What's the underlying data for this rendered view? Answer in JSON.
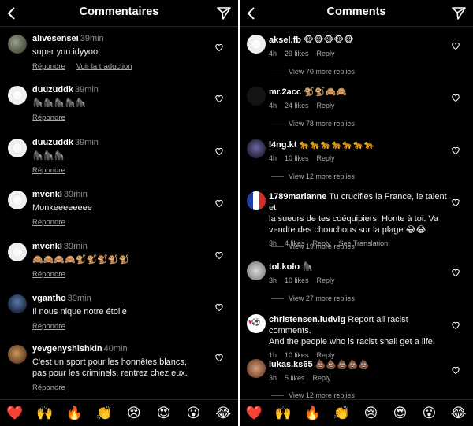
{
  "left": {
    "title": "Commentaires",
    "comments": [
      {
        "user": "alivesensei",
        "time": "39min",
        "text": "super you idyyoot",
        "reply": "Répondre",
        "translate": "Voir la traduction",
        "avatar": "photo-thumbnail"
      },
      {
        "user": "duuzuddk",
        "time": "39min",
        "text": "🦍🦍🦍🦍🦍",
        "reply": "Répondre",
        "avatar": "default-avatar"
      },
      {
        "user": "duuzuddk",
        "time": "39min",
        "text": "🦍🦍🦍",
        "reply": "Répondre",
        "avatar": "default-avatar"
      },
      {
        "user": "mvcnkl",
        "time": "39min",
        "text": "Monkeeeeeeee",
        "reply": "Répondre",
        "avatar": "default-avatar"
      },
      {
        "user": "mvcnkl",
        "time": "39min",
        "text": "🙈🙈🙈🙈🐒🐒🐒🐒🐒",
        "reply": "Répondre",
        "avatar": "default-avatar"
      },
      {
        "user": "vgantho",
        "time": "39min",
        "text": "Il nous nique notre étoile",
        "reply": "Répondre",
        "avatar": "photo-thumbnail"
      },
      {
        "user": "yevgenyshishkin",
        "time": "40min",
        "text_line1": "C'est un sport pour les honnêtes blancs,",
        "text_line2": "pas pour les criminels, rentrez chez eux.",
        "reply": "Répondre",
        "avatar": "painting-thumbnail"
      }
    ],
    "emojis": [
      "❤️",
      "🙌",
      "🔥",
      "👏",
      "😢",
      "😍",
      "😮",
      "😂"
    ]
  },
  "right": {
    "title": "Comments",
    "comments": [
      {
        "user": "aksel.fb",
        "text": "🐵🐵🐵🐵🐵",
        "time": "4h",
        "likes": "29 likes",
        "reply": "Reply",
        "more": "View 70 more replies",
        "avatar": "default-avatar"
      },
      {
        "user": "mr.2acc",
        "text": "🐒🐒🙈🙈",
        "time": "4h",
        "likes": "24 likes",
        "reply": "Reply",
        "more": "View 78 more replies",
        "avatar": "dark-avatar"
      },
      {
        "user": "l4ng.kt",
        "text": "🐆🐆🐆🐆🐆🐆🐆",
        "time": "4h",
        "likes": "10 likes",
        "reply": "Reply",
        "more": "View 12 more replies",
        "avatar": "photo-thumbnail"
      },
      {
        "user": "1789marianne",
        "text_line1": "Tu crucifies la France, le talent et",
        "text_line2": "la sueurs de tes coéquipiers. Honte à toi. Va",
        "text_line3": "vendre des chouchous sur la plage 😂😂",
        "time": "3h",
        "likes": "4 likes",
        "reply": "Reply",
        "translate": "See Translation",
        "more": "View 19 more replies",
        "avatar": "flag-avatar"
      },
      {
        "user": "tol.kolo",
        "text": "🦍",
        "time": "3h",
        "likes": "10 likes",
        "reply": "Reply",
        "more": "View 27 more replies",
        "avatar": "photo-thumbnail"
      },
      {
        "user": "christensen.ludvig",
        "text_line1": "Report all racist comments.",
        "text_line2": "And the people who is racist shall get a life!",
        "time": "1h",
        "likes": "10 likes",
        "reply": "Reply",
        "avatar": "heart-avatar"
      },
      {
        "user": "lukas.ks65",
        "text": "💩💩💩💩💩",
        "time": "3h",
        "likes": "5 likes",
        "reply": "Reply",
        "more": "View 12 more replies",
        "avatar": "photo-thumbnail"
      }
    ],
    "emojis": [
      "❤️",
      "🙌",
      "🔥",
      "👏",
      "😢",
      "😍",
      "😮",
      "😂"
    ]
  },
  "colors": {
    "background": "#000000",
    "text": "#f5f5f5",
    "muted": "#a8a8a8",
    "divider": "#262626"
  },
  "icons": [
    "back-arrow-icon",
    "send-paper-plane-icon",
    "heart-outline-icon"
  ]
}
